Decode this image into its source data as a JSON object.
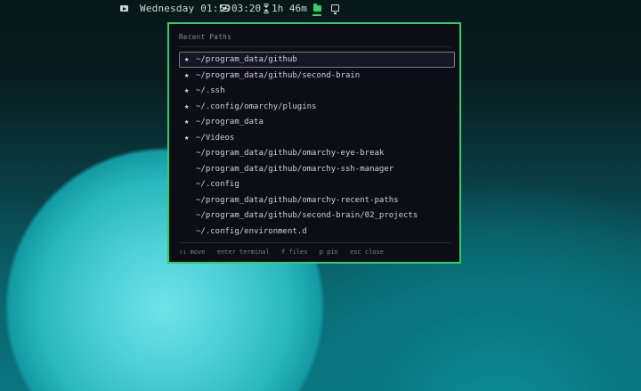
{
  "topbar": {
    "video_icon": "youtube-icon",
    "clock": "Wednesday 01:59",
    "eye_icon": "eye-icon",
    "eye_time": "03:20",
    "timer_icon": "hourglass-icon",
    "timer_value": "1h 46m",
    "folder_icon": "folder-icon",
    "monitor_icon": "monitor-icon",
    "accent_color": "#2fce6a"
  },
  "picker": {
    "title": "Recent Paths",
    "border_color": "#2fce6a",
    "pin_symbol": "★",
    "paths": [
      {
        "path": "~/program_data/github",
        "pinned": true,
        "selected": true
      },
      {
        "path": "~/program_data/github/second-brain",
        "pinned": true,
        "selected": false
      },
      {
        "path": "~/.ssh",
        "pinned": true,
        "selected": false
      },
      {
        "path": "~/.config/omarchy/plugins",
        "pinned": true,
        "selected": false
      },
      {
        "path": "~/program_data",
        "pinned": true,
        "selected": false
      },
      {
        "path": "~/Videos",
        "pinned": true,
        "selected": false
      },
      {
        "path": "~/program_data/github/omarchy-eye-break",
        "pinned": false,
        "selected": false
      },
      {
        "path": "~/program_data/github/omarchy-ssh-manager",
        "pinned": false,
        "selected": false
      },
      {
        "path": "~/.config",
        "pinned": false,
        "selected": false
      },
      {
        "path": "~/program_data/github/omarchy-recent-paths",
        "pinned": false,
        "selected": false
      },
      {
        "path": "~/program_data/github/second-brain/02_projects",
        "pinned": false,
        "selected": false
      },
      {
        "path": "~/.config/environment.d",
        "pinned": false,
        "selected": false
      }
    ],
    "footer": {
      "move": "↑↓ move",
      "terminal": "enter terminal",
      "files": "f files",
      "pin": "p pin",
      "close": "esc close"
    }
  }
}
